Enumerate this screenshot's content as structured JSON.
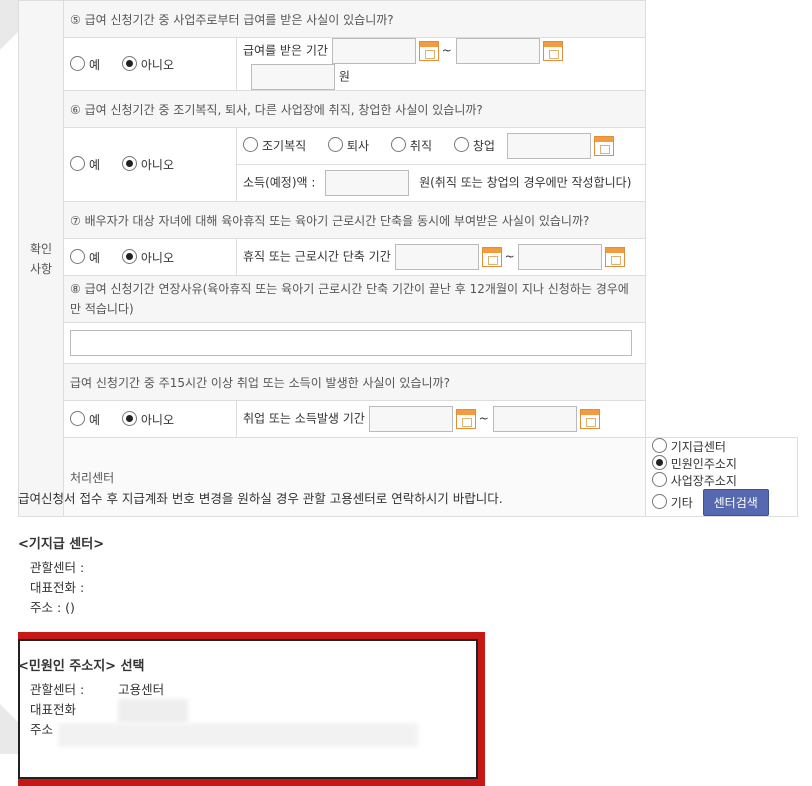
{
  "q5": {
    "text": "⑤ 급여 신청기간 중 사업주로부터 급여를 받은 사실이 있습니까?",
    "yes": "예",
    "no": "아니오",
    "period_label": "급여를 받은 기간",
    "tilde": "~",
    "unit": "원"
  },
  "q6": {
    "text": "⑥ 급여 신청기간 중 조기복직, 퇴사, 다른 사업장에 취직, 창업한 사실이 있습니까?",
    "yes": "예",
    "no": "아니오",
    "options": [
      "조기복직",
      "퇴사",
      "취직",
      "창업"
    ],
    "income_label": "소득(예정)액 :",
    "income_note": "원(취직 또는 창업의 경우에만 작성합니다)"
  },
  "side_label": "확인사항",
  "q7": {
    "text": "⑦ 배우자가 대상 자녀에 대해 육아휴직 또는 육아기 근로시간 단축을 동시에 부여받은 사실이 있습니까?",
    "yes": "예",
    "no": "아니오",
    "period_label": "휴직 또는 근로시간 단축 기간",
    "tilde": "~"
  },
  "q8": {
    "text": "⑧ 급여 신청기간 연장사유(육아휴직 또는 육아기 근로시간 단축 기간이 끝난 후 12개월이 지나 신청하는 경우에만 적습니다)"
  },
  "q9": {
    "text": "급여 신청기간 중 주15시간 이상 취업 또는 소득이 발생한 사실이 있습니까?",
    "yes": "예",
    "no": "아니오",
    "period_label": "취업 또는 소득발생 기간",
    "tilde": "~"
  },
  "center": {
    "label": "처리센터",
    "options": [
      "기지급센터",
      "민원인주소지",
      "사업장주소지",
      "기타"
    ],
    "search_button": "센터검색"
  },
  "notes": {
    "notice": "급여신청서 접수 후 지급계좌 번호 변경을 원하실 경우 관할 고용센터로 연락하시기 바랍니다.",
    "prev_title": "<기지급 센터>",
    "prev_lines": [
      "관할센터 :",
      "대표전화 :",
      "주소 : ()"
    ],
    "addr_title": "<민원인 주소지> 선택",
    "addr_center_label": "관할센터 :",
    "addr_center_value": "고용센터",
    "addr_phone_label": "대표전화",
    "addr_address_label": "주소"
  }
}
